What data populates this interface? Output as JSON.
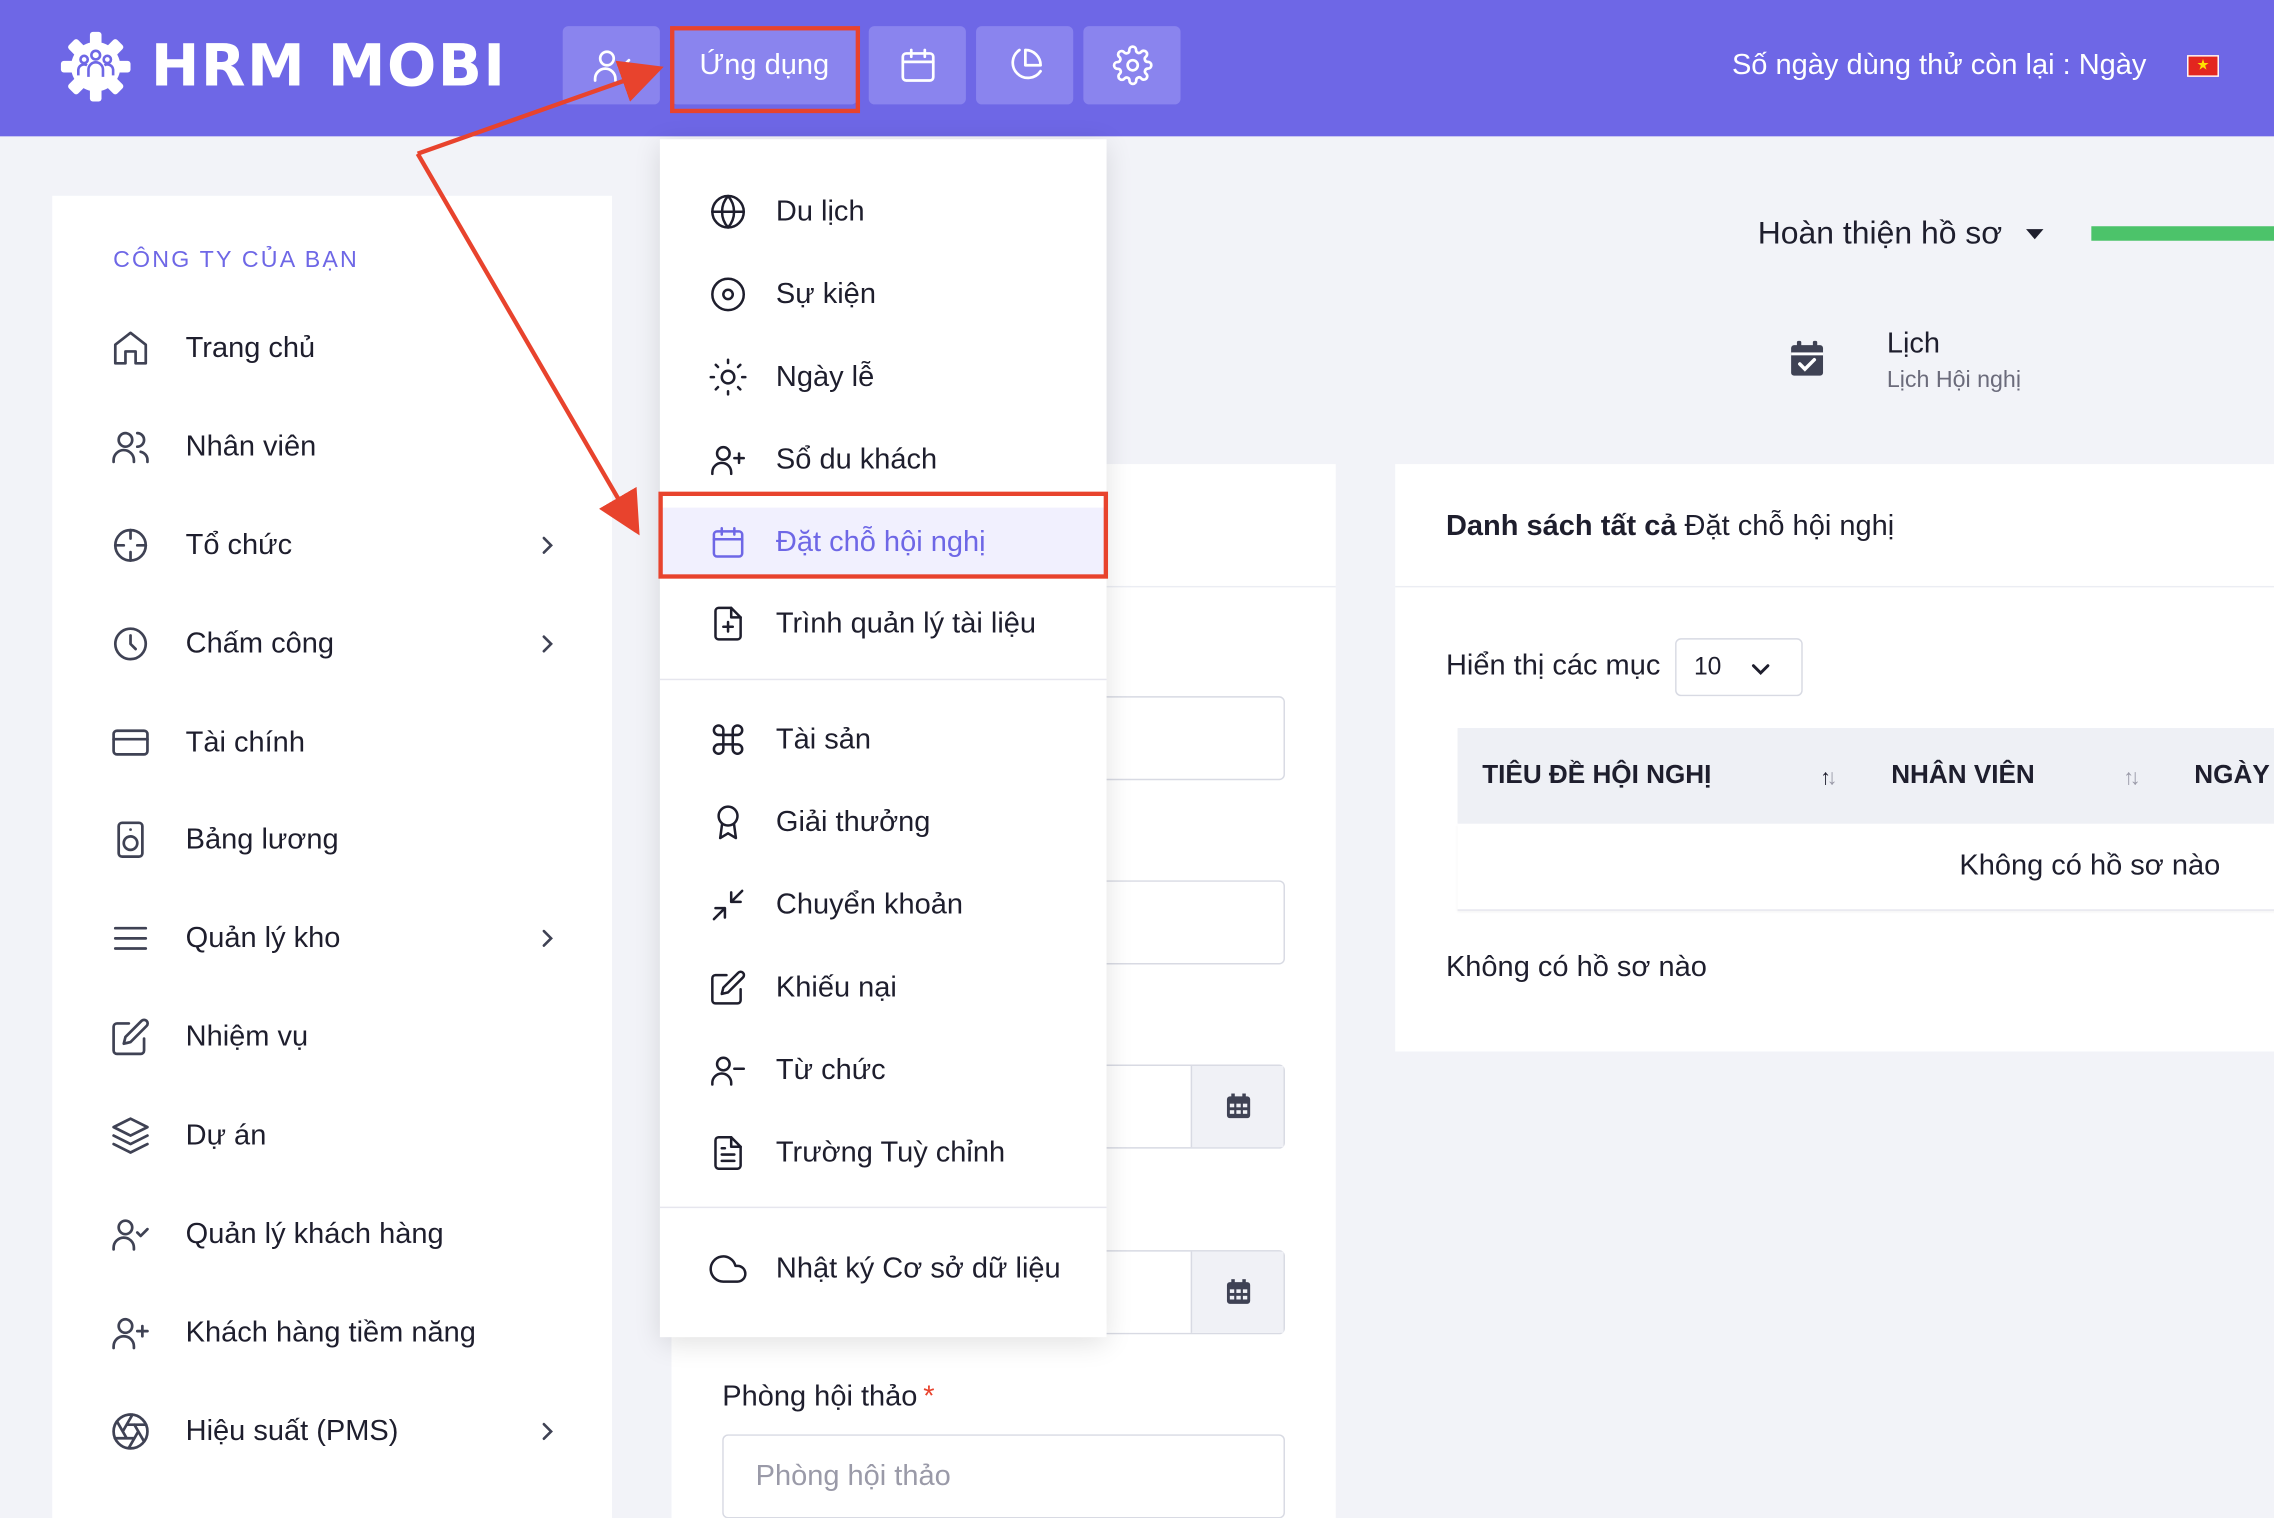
{
  "header": {
    "brand": "HRM MOBI",
    "apps_label": "Ứng dụng",
    "trial_text": "Số ngày dùng thử còn lại : Ngày",
    "flag_symbol": "★",
    "bg_color": "#6e67e6",
    "highlight_color": "#e8432d"
  },
  "sidebar": {
    "title": "CÔNG TY CỦA BẠN",
    "items": [
      {
        "label": "Trang chủ",
        "icon": "home-icon",
        "has_children": false
      },
      {
        "label": "Nhân viên",
        "icon": "users-icon",
        "has_children": false
      },
      {
        "label": "Tổ chức",
        "icon": "crosshair-icon",
        "has_children": true
      },
      {
        "label": "Chấm công",
        "icon": "clock-icon",
        "has_children": true
      },
      {
        "label": "Tài chính",
        "icon": "credit-card-icon",
        "has_children": false
      },
      {
        "label": "Bảng lương",
        "icon": "payroll-icon",
        "has_children": false
      },
      {
        "label": "Quản lý kho",
        "icon": "menu-icon",
        "has_children": true
      },
      {
        "label": "Nhiệm vụ",
        "icon": "edit-icon",
        "has_children": false
      },
      {
        "label": "Dự án",
        "icon": "layers-icon",
        "has_children": false
      },
      {
        "label": "Quản lý khách hàng",
        "icon": "user-check-icon",
        "has_children": false
      },
      {
        "label": "Khách hàng tiềm năng",
        "icon": "user-plus-icon",
        "has_children": false
      },
      {
        "label": "Hiệu suất (PMS)",
        "icon": "aperture-icon",
        "has_children": true
      }
    ]
  },
  "dropdown": {
    "items": [
      {
        "label": "Du lịch",
        "icon": "globe-icon"
      },
      {
        "label": "Sự kiện",
        "icon": "target-icon"
      },
      {
        "label": "Ngày lễ",
        "icon": "sun-icon"
      },
      {
        "label": "Sổ du khách",
        "icon": "user-plus-icon"
      },
      {
        "label": "Đặt chỗ hội nghị",
        "icon": "calendar-icon",
        "active": true
      },
      {
        "label": "Trình quản lý tài liệu",
        "icon": "file-plus-icon"
      },
      {
        "label": "Tài sản",
        "icon": "command-icon"
      },
      {
        "label": "Giải thưởng",
        "icon": "award-icon"
      },
      {
        "label": "Chuyển khoản",
        "icon": "minimize-icon"
      },
      {
        "label": "Khiếu nại",
        "icon": "edit-icon"
      },
      {
        "label": "Từ chức",
        "icon": "user-minus-icon"
      },
      {
        "label": "Trường Tuỳ chỉnh",
        "icon": "file-text-icon"
      },
      {
        "label": "Nhật ký Cơ sở dữ liệu",
        "icon": "cloud-icon"
      }
    ]
  },
  "main": {
    "profile_label": "Hoàn thiện hồ sơ",
    "profile_progress_percent": 100,
    "breadcrumb_title": "Lịch",
    "breadcrumb_sub": "Lịch Hội nghị",
    "form": {
      "room_label": "Phòng hội thảo",
      "room_placeholder": "Phòng hội thảo"
    },
    "list": {
      "title_bold": "Danh sách tất cả",
      "title_rest": " Đặt chỗ hội nghị",
      "show_label": "Hiển thị các mục",
      "page_size": "10",
      "columns": [
        "TIÊU ĐỀ HỘI NGHỊ",
        "NHÂN VIÊN",
        "NGÀY"
      ],
      "empty_row": "Không có hồ sơ nào",
      "empty_note": "Không có hồ sơ nào"
    }
  }
}
